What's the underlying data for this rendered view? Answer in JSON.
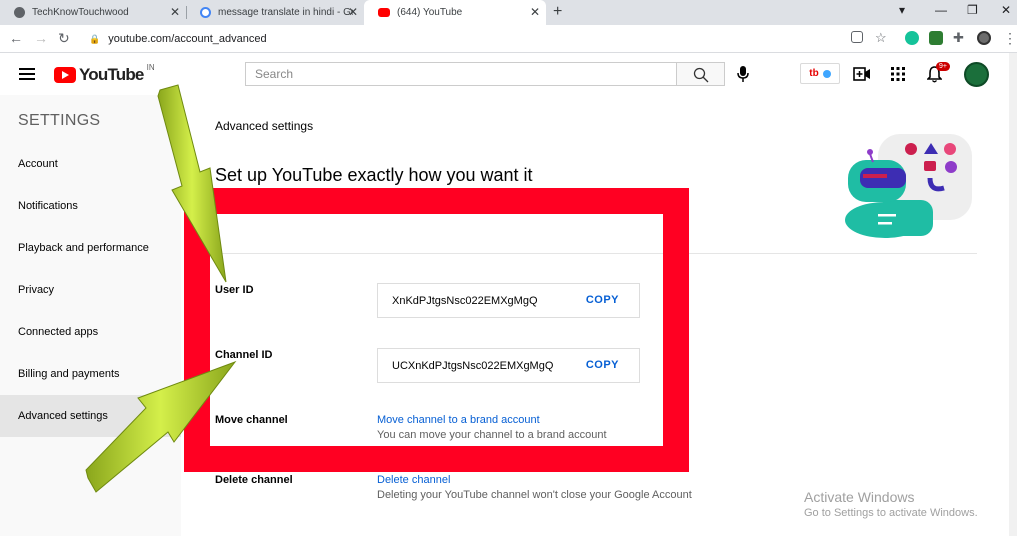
{
  "browser": {
    "tabs": [
      {
        "title": "TechKnowTouchwood",
        "active": false
      },
      {
        "title": "message translate in hindi - Goog",
        "active": false
      },
      {
        "title": "(644) YouTube",
        "active": true
      }
    ],
    "url": "youtube.com/account_advanced"
  },
  "header": {
    "logo_text": "YouTube",
    "country_code": "IN",
    "search_placeholder": "Search",
    "ext_badge_text": "tb",
    "notification_count": "9+"
  },
  "sidebar": {
    "title": "SETTINGS",
    "items": [
      {
        "label": "Account",
        "active": false
      },
      {
        "label": "Notifications",
        "active": false
      },
      {
        "label": "Playback and performance",
        "active": false
      },
      {
        "label": "Privacy",
        "active": false
      },
      {
        "label": "Connected apps",
        "active": false
      },
      {
        "label": "Billing and payments",
        "active": false
      },
      {
        "label": "Advanced settings",
        "active": true
      }
    ]
  },
  "main": {
    "heading": "Advanced settings",
    "hero": "Set up YouTube exactly how you want it",
    "user_id": {
      "label": "User ID",
      "value": "XnKdPJtgsNsc022EMXgMgQ",
      "copy_label": "COPY"
    },
    "channel_id": {
      "label": "Channel ID",
      "value": "UCXnKdPJtgsNsc022EMXgMgQ",
      "copy_label": "COPY"
    },
    "move_channel": {
      "label": "Move channel",
      "link": "Move channel to a brand account",
      "desc": "You can move your channel to a brand account"
    },
    "delete_channel": {
      "label": "Delete channel",
      "link": "Delete channel",
      "desc": "Deleting your YouTube channel won't close your Google Account"
    }
  },
  "watermark": {
    "line1": "Activate Windows",
    "line2": "Go to Settings to activate Windows."
  },
  "colors": {
    "highlight": "#ff0022",
    "arrow": "#b5d334",
    "link": "#065fd4"
  }
}
